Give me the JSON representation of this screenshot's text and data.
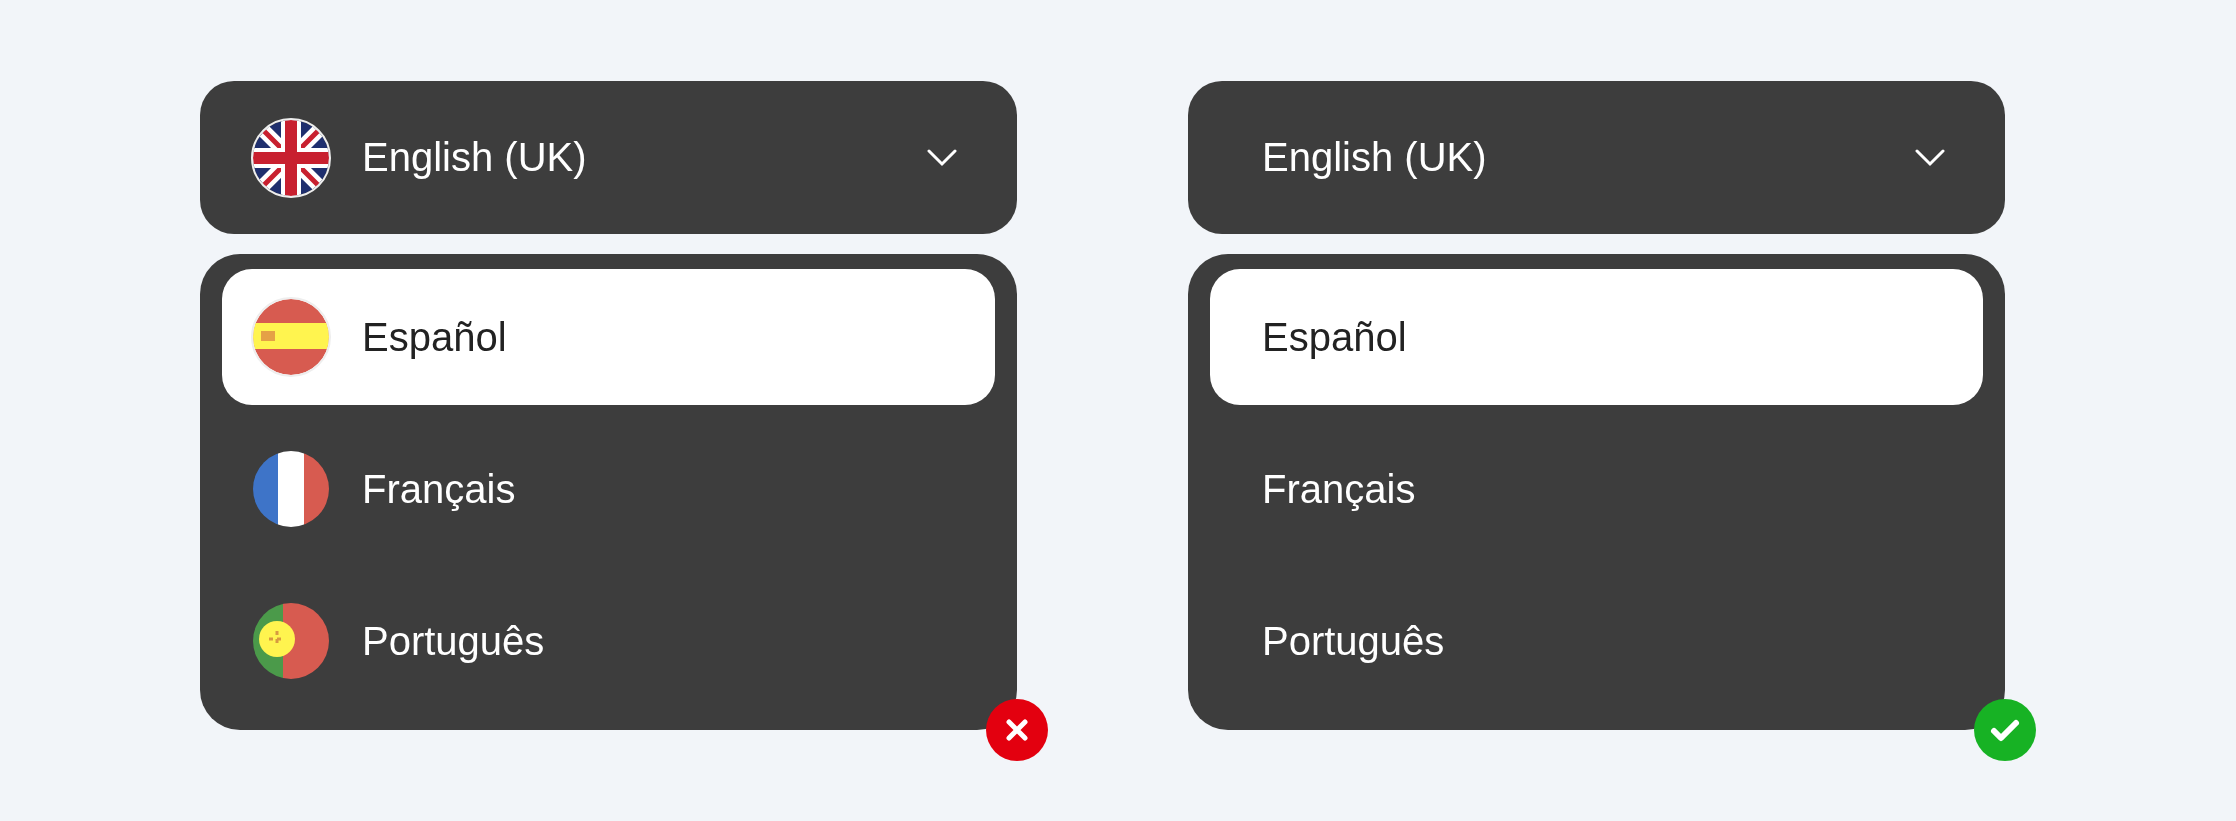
{
  "panels": [
    {
      "badge": {
        "kind": "cross"
      },
      "selector": {
        "label": "English (UK)",
        "kind": "uk"
      },
      "options": [
        {
          "label": "Español",
          "kind": "es",
          "selected": true
        },
        {
          "label": "Français",
          "kind": "fr",
          "selected": false
        },
        {
          "label": "Português",
          "kind": "pt",
          "selected": false
        }
      ]
    },
    {
      "badge": {
        "kind": "check"
      },
      "selector": {
        "label": "English (UK)",
        "kind": "plain"
      },
      "options": [
        {
          "label": "Español",
          "kind": "plain",
          "selected": true
        },
        {
          "label": "Français",
          "kind": "plain",
          "selected": false
        },
        {
          "label": "Português",
          "kind": "plain",
          "selected": false
        }
      ]
    }
  ]
}
